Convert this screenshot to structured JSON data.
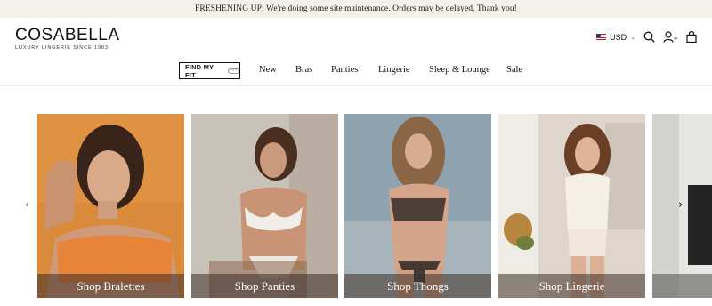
{
  "announcement": "FRESHENING UP: We're doing some site maintenance. Orders may be delayed. Thank you!",
  "logo": {
    "name": "COSABELLA",
    "tagline": "LUXURY LINGERIE SINCE 1983"
  },
  "header_tools": {
    "currency": "USD",
    "icons": [
      "us-flag-icon",
      "chevron-down-icon",
      "search-icon",
      "account-icon",
      "bag-icon"
    ]
  },
  "nav": {
    "fit_button": "FIND MY FIT",
    "items": [
      "New",
      "Bras",
      "Panties",
      "Lingerie",
      "Sleep & Lounge",
      "Sale"
    ]
  },
  "carousel": {
    "prev_icon": "chevron-left-icon",
    "next_icon": "chevron-right-icon",
    "cards": [
      {
        "caption": "Shop Bralettes",
        "bg": "#d98a3a"
      },
      {
        "caption": "Shop Panties",
        "bg": "#c9c2b8"
      },
      {
        "caption": "Shop Thongs",
        "bg": "#8fa2b0"
      },
      {
        "caption": "Shop Lingerie",
        "bg": "#ded6cc"
      }
    ]
  }
}
